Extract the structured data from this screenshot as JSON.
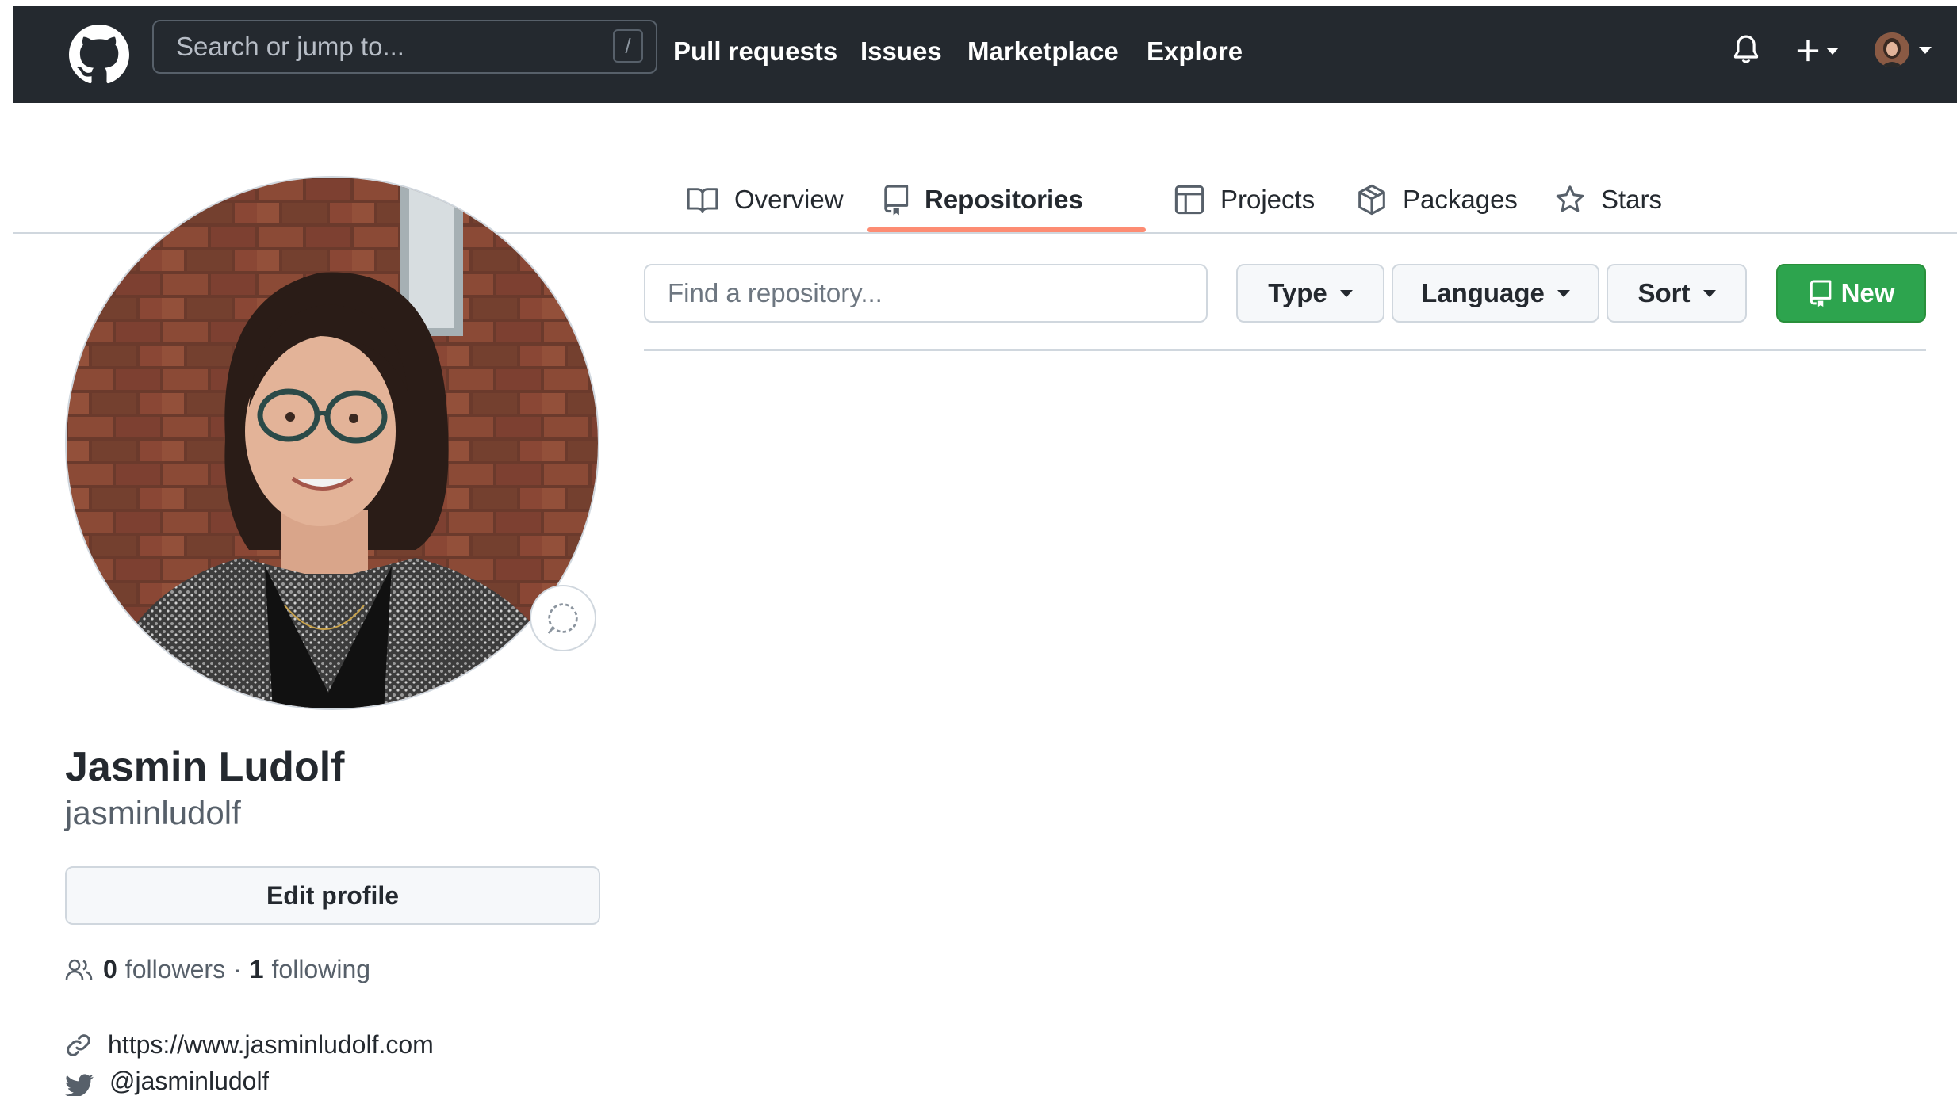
{
  "header": {
    "search_placeholder": "Search or jump to...",
    "search_shortcut": "/",
    "nav": {
      "pull_requests": "Pull requests",
      "issues": "Issues",
      "marketplace": "Marketplace",
      "explore": "Explore"
    },
    "icons": {
      "logo": "github-logo-icon",
      "notifications": "bell-icon",
      "create": "plus-icon",
      "avatar": "avatar-menu"
    }
  },
  "tabs": {
    "overview": "Overview",
    "repositories": "Repositories",
    "projects": "Projects",
    "packages": "Packages",
    "stars": "Stars",
    "active": "repositories"
  },
  "profile": {
    "full_name": "Jasmin Ludolf",
    "username": "jasminludolf",
    "edit_label": "Edit profile",
    "followers_count": "0",
    "followers_label": "followers",
    "separator": "·",
    "following_count": "1",
    "following_label": "following",
    "website": "https://www.jasminludolf.com",
    "twitter": "@jasminludolf"
  },
  "repo_bar": {
    "find_placeholder": "Find a repository...",
    "type_label": "Type",
    "language_label": "Language",
    "sort_label": "Sort",
    "new_label": "New"
  },
  "colors": {
    "header_bg": "#24292f",
    "active_tab_underline": "#fd8c73",
    "new_button": "#2da44e"
  }
}
